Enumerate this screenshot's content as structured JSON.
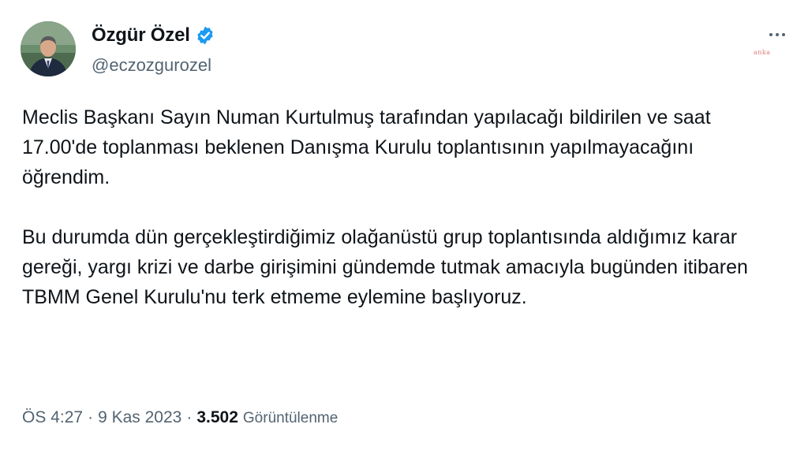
{
  "author": {
    "display_name": "Özgür Özel",
    "handle": "@eczozgurozel",
    "verified_icon": "verified-badge-icon",
    "avatar_icon": "profile-photo"
  },
  "watermark": "anka",
  "menu": {
    "icon": "more-horizontal-icon"
  },
  "tweet": {
    "paragraph_1": "Meclis Başkanı Sayın Numan Kurtulmuş tarafından yapılacağı bildirilen ve saat 17.00'de toplanması beklenen Danışma Kurulu toplantısının yapılmayacağını öğrendim.",
    "paragraph_2": "Bu durumda dün gerçekleştirdiğimiz olağanüstü grup toplantısında aldığımız karar gereği, yargı krizi ve darbe girişimini gündemde tutmak amacıyla bugünden itibaren TBMM Genel Kurulu'nu terk etmeme eylemine başlıyoruz."
  },
  "meta": {
    "time": "ÖS 4:27",
    "sep1": "·",
    "date": "9 Kas 2023",
    "sep2": "·",
    "views_count": "3.502",
    "views_label": "Görüntülenme"
  },
  "colors": {
    "verified": "#1d9bf0",
    "secondary_text": "#536471",
    "primary_text": "#0f1419"
  }
}
